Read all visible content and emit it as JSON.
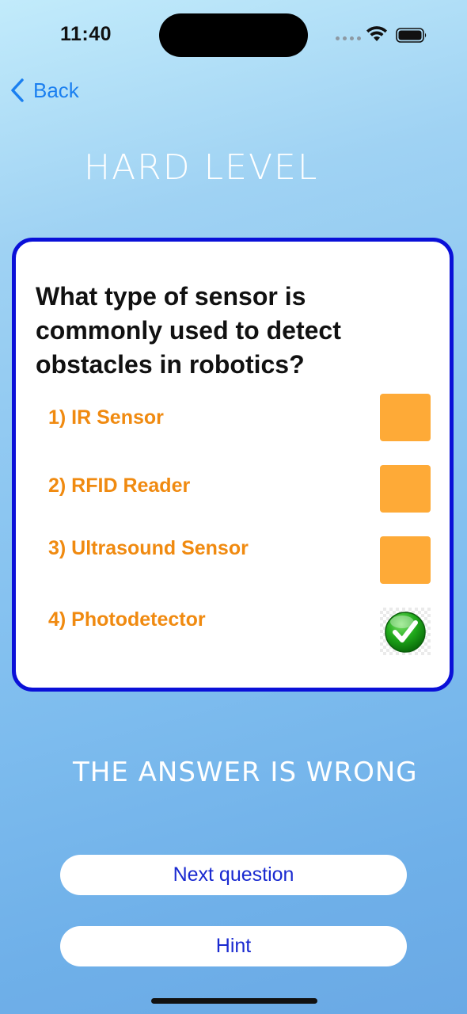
{
  "status_bar": {
    "time": "11:40",
    "icons": [
      "signal-dots-icon",
      "wifi-icon",
      "battery-icon"
    ]
  },
  "nav": {
    "back_label": "Back",
    "back_icon": "chevron-left-icon"
  },
  "level_title": "Hard Level",
  "question": {
    "text": "What type of sensor is commonly used to detect obstacles in robotics?",
    "options": [
      {
        "label": "1) IR Sensor",
        "state": "unchecked"
      },
      {
        "label": "2) RFID Reader",
        "state": "unchecked"
      },
      {
        "label": "3) Ultrasound Sensor",
        "state": "unchecked"
      },
      {
        "label": "4) Photodetector",
        "state": "checked"
      }
    ]
  },
  "result_text": "The answer is wrong",
  "buttons": {
    "next_label": "Next question",
    "hint_label": "Hint"
  },
  "colors": {
    "accent": "#1a7ff0",
    "card_border": "#0a10d8",
    "option_text": "#f08a10",
    "option_box": "#feaa37",
    "button_text": "#1a2ad0"
  }
}
